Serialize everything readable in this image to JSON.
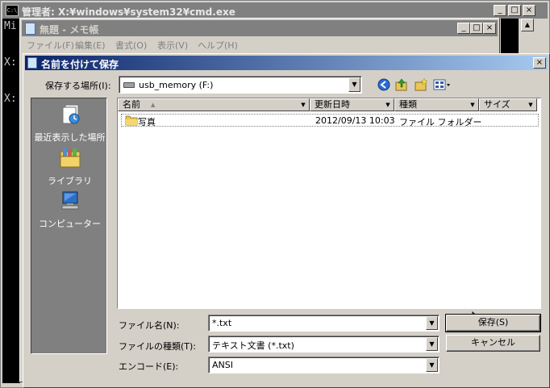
{
  "cmd": {
    "title": "管理者: X:¥windows¥system32¥cmd.exe",
    "icon_text": "C:\\",
    "console_lines": [
      "Mi",
      "X:",
      "X:"
    ]
  },
  "notepad": {
    "title": "無題 - メモ帳",
    "menu": [
      "ファイル(F)",
      "編集(E)",
      "書式(O)",
      "表示(V)",
      "ヘルプ(H)"
    ]
  },
  "dialog": {
    "title": "名前を付けて保存",
    "location_label": "保存する場所(I):",
    "location_value": "usb_memory (F:)",
    "places": [
      {
        "label": "最近表示した場所",
        "icon": "recent-places-icon"
      },
      {
        "label": "ライブラリ",
        "icon": "library-icon"
      },
      {
        "label": "コンピューター",
        "icon": "computer-icon"
      }
    ],
    "columns": [
      "名前",
      "更新日時",
      "種類",
      "サイズ"
    ],
    "files": [
      {
        "name": "写真",
        "modified": "2012/09/13 10:03",
        "type": "ファイル フォルダー",
        "size": ""
      }
    ],
    "filename_label": "ファイル名(N):",
    "filename_value": "*.txt",
    "filetype_label": "ファイルの種類(T):",
    "filetype_value": "テキスト文書 (*.txt)",
    "encoding_label": "エンコード(E):",
    "encoding_value": "ANSI",
    "save_button": "保存(S)",
    "cancel_button": "キャンセル"
  },
  "window_buttons": {
    "minimize": "_",
    "maximize": "□",
    "close": "×"
  },
  "colors": {
    "title_active": "#0a246a",
    "title_inactive": "#808080",
    "face": "#d4d0c8"
  }
}
